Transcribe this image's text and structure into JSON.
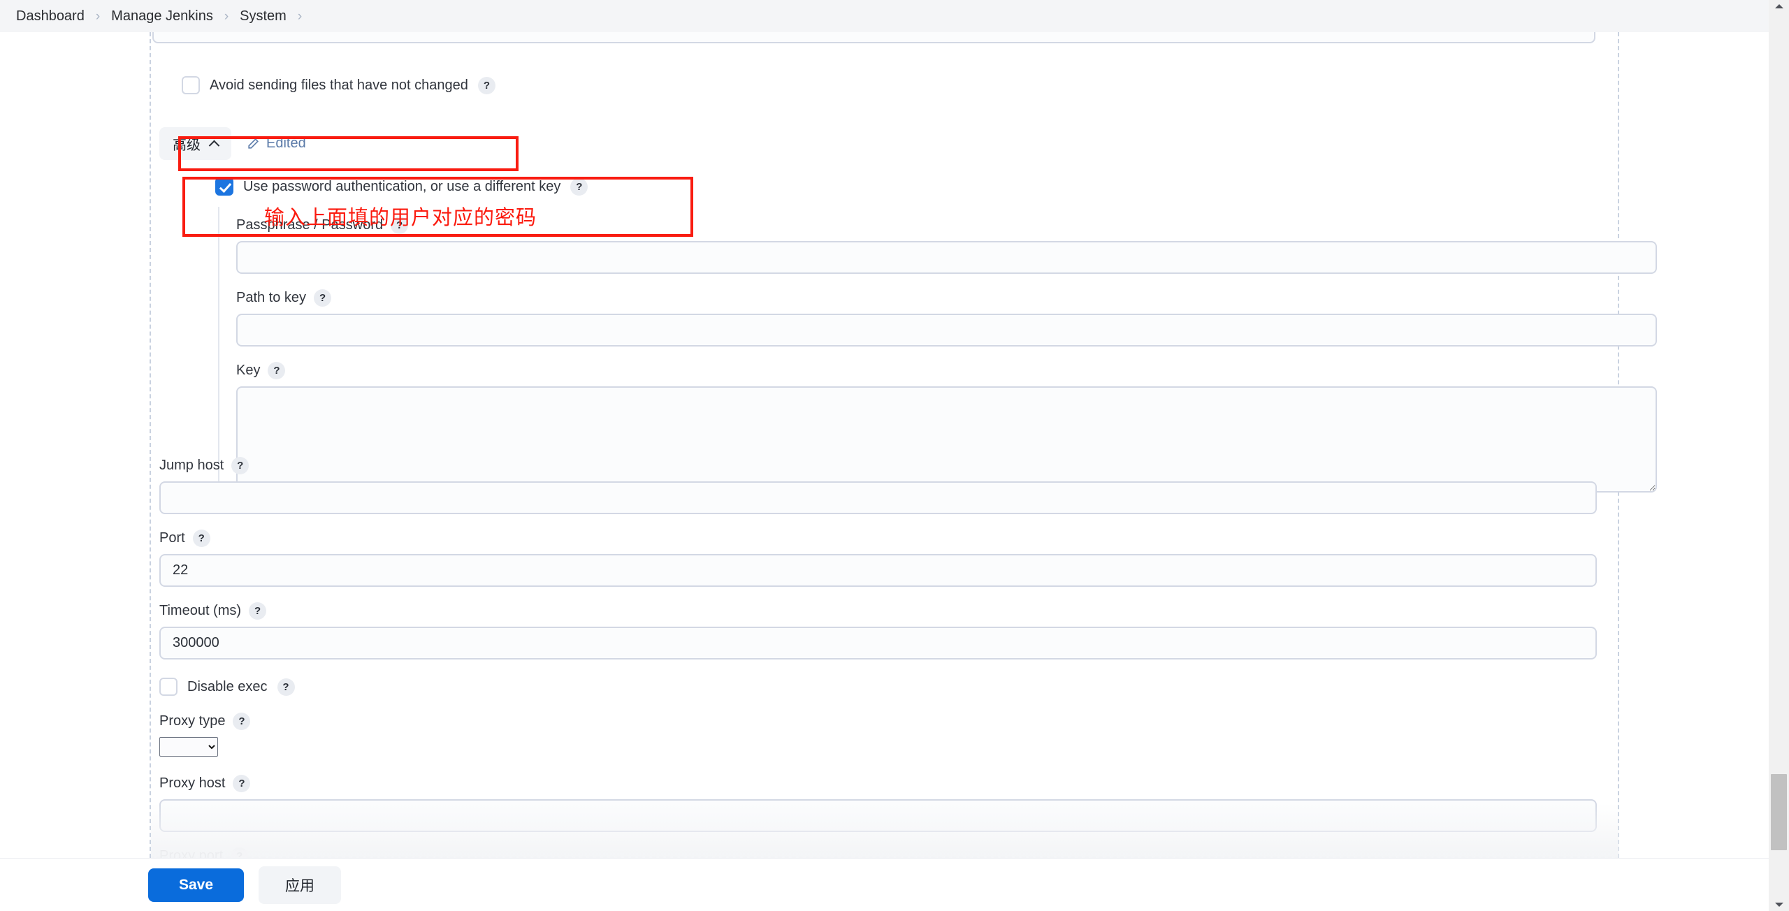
{
  "breadcrumb": {
    "items": [
      {
        "label": "Dashboard"
      },
      {
        "label": "Manage Jenkins"
      },
      {
        "label": "System"
      }
    ],
    "separator": "›"
  },
  "form": {
    "avoid_sending": {
      "label": "Avoid sending files that have not changed",
      "checked": false,
      "help": "?"
    },
    "advanced_button": {
      "label": "高级"
    },
    "edited_link": {
      "label": "Edited"
    },
    "use_password_auth": {
      "label": "Use password authentication, or use a different key",
      "checked": true,
      "help": "?"
    },
    "passphrase": {
      "label": "Passphrase / Password",
      "help": "?",
      "value": "",
      "placeholder": ""
    },
    "path_to_key": {
      "label": "Path to key",
      "help": "?",
      "value": "",
      "placeholder": ""
    },
    "key": {
      "label": "Key",
      "help": "?",
      "value": "",
      "placeholder": ""
    },
    "jump_host": {
      "label": "Jump host",
      "help": "?",
      "value": "",
      "placeholder": ""
    },
    "port": {
      "label": "Port",
      "help": "?",
      "value": "22",
      "placeholder": ""
    },
    "timeout": {
      "label": "Timeout (ms)",
      "help": "?",
      "value": "300000",
      "placeholder": ""
    },
    "disable_exec": {
      "label": "Disable exec",
      "checked": false,
      "help": "?"
    },
    "proxy_type": {
      "label": "Proxy type",
      "help": "?",
      "selected": "",
      "options": [
        ""
      ]
    },
    "proxy_host": {
      "label": "Proxy host",
      "help": "?",
      "value": "",
      "placeholder": ""
    },
    "proxy_port": {
      "label": "Proxy port",
      "help": "?"
    }
  },
  "annotations": {
    "password_hint": "输入上面填的用户对应的密码",
    "color": "#f91c11"
  },
  "actions": {
    "save_label": "Save",
    "apply_label": "应用"
  },
  "colors": {
    "accent_blue": "#0a6cdc",
    "checkbox_blue": "#1c75e0",
    "annotation_red": "#f91c11",
    "header_bg": "#f4f5f7"
  }
}
